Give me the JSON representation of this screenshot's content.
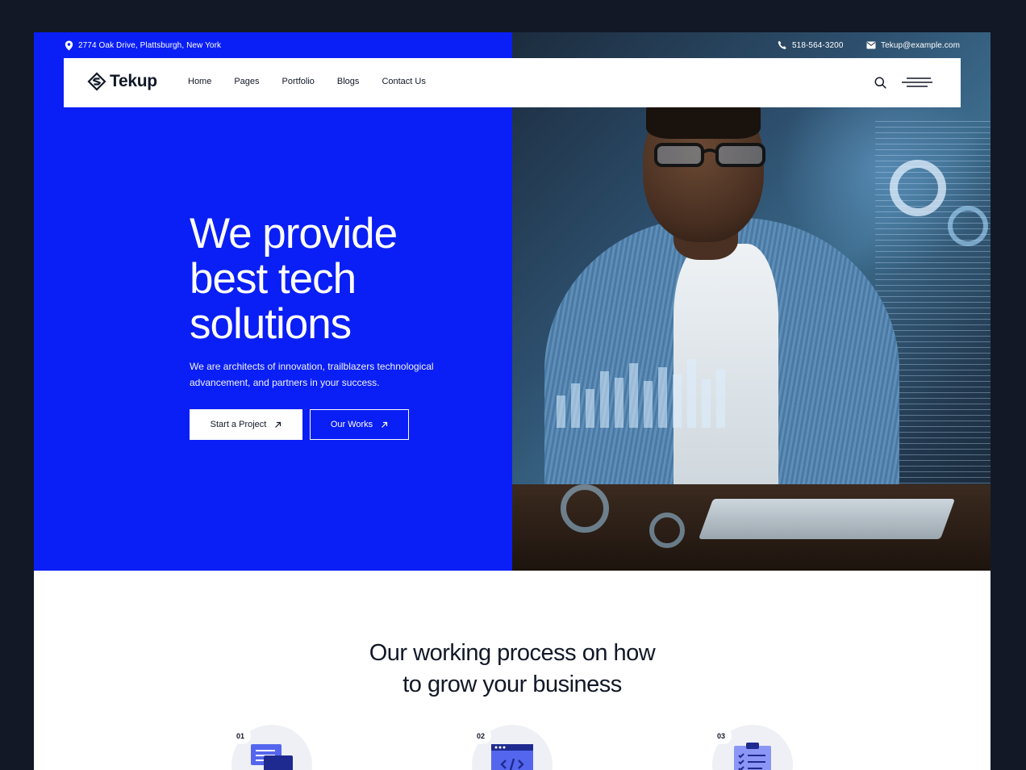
{
  "topbar": {
    "address": "2774 Oak Drive, Plattsburgh, New York",
    "phone": "518-564-3200",
    "email": "Tekup@example.com"
  },
  "nav": {
    "logo": "Tekup",
    "links": [
      "Home",
      "Pages",
      "Portfolio",
      "Blogs",
      "Contact Us"
    ]
  },
  "hero": {
    "title_lines": [
      "We provide",
      "best tech",
      "solutions"
    ],
    "description": "We are architects of innovation, trailblazers technological advancement, and partners in your success.",
    "primary_button": "Start a Project",
    "secondary_button": "Our Works"
  },
  "process": {
    "title_lines": [
      "Our working process on how",
      "to grow your business"
    ],
    "steps": [
      {
        "number": "01",
        "icon": "chat-bubbles-icon"
      },
      {
        "number": "02",
        "icon": "code-window-icon"
      },
      {
        "number": "03",
        "icon": "clipboard-checklist-icon"
      }
    ]
  },
  "colors": {
    "brand_blue": "#0a1ff5",
    "dark_frame": "#121826",
    "text_dark": "#111827",
    "step_bg": "#eef0f5",
    "icon_blue": "#3346e6"
  }
}
